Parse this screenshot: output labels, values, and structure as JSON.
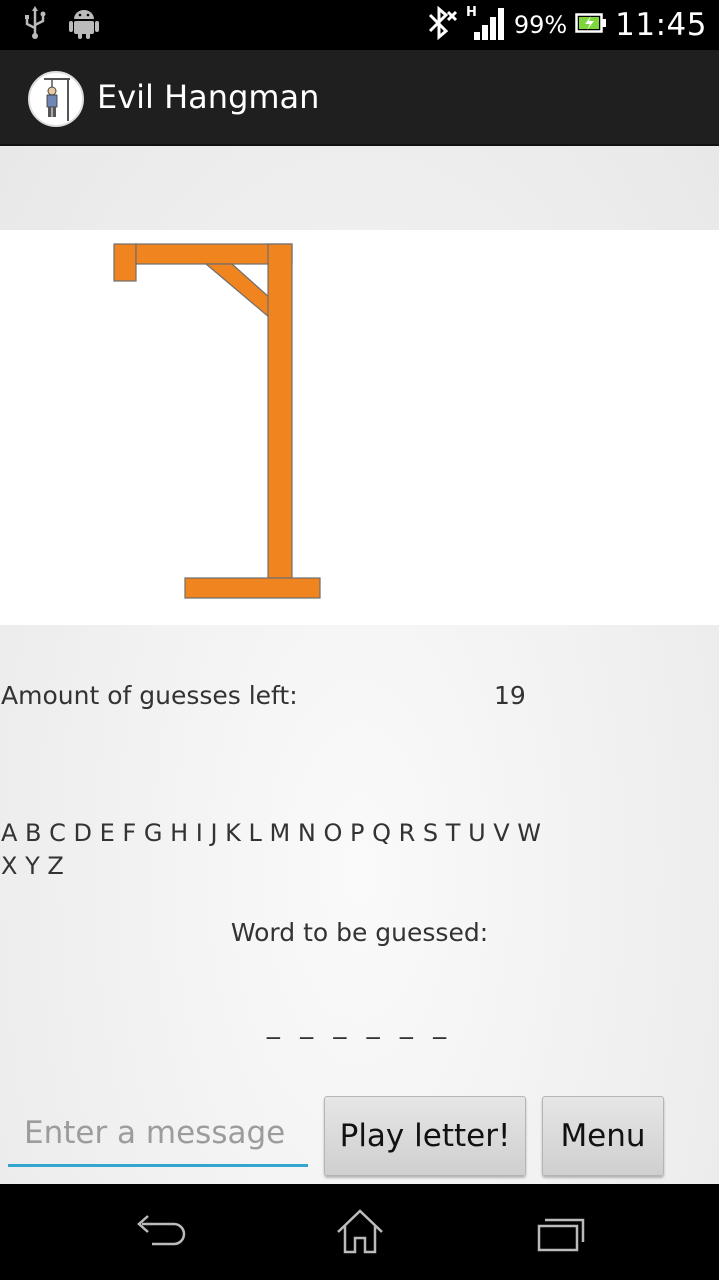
{
  "status_bar": {
    "battery_percent": "99%",
    "time": "11:45",
    "network_type": "H",
    "icons": [
      "usb-icon",
      "android-icon",
      "bluetooth-icon",
      "signal-icon",
      "battery-icon"
    ]
  },
  "action_bar": {
    "title": "Evil Hangman",
    "icon": "hangman-app-icon"
  },
  "game": {
    "guesses_label": "Amount of guesses left:",
    "guesses_left": "19",
    "alphabet_row1": "A B C D E F G H I J K L M N O P Q R S T U V W",
    "alphabet_row2": "X Y Z",
    "word_label": "Word to be guessed:",
    "word_display": "_ _ _ _ _ _"
  },
  "input": {
    "placeholder": "Enter a message",
    "value": ""
  },
  "buttons": {
    "play_label": "Play letter!",
    "menu_label": "Menu"
  },
  "colors": {
    "gallows": "#f0841f",
    "input_underline": "#33a5d0",
    "action_bar": "#1f1f1f"
  },
  "nav_bar": {
    "icons": [
      "back-icon",
      "home-icon",
      "recent-apps-icon"
    ]
  }
}
